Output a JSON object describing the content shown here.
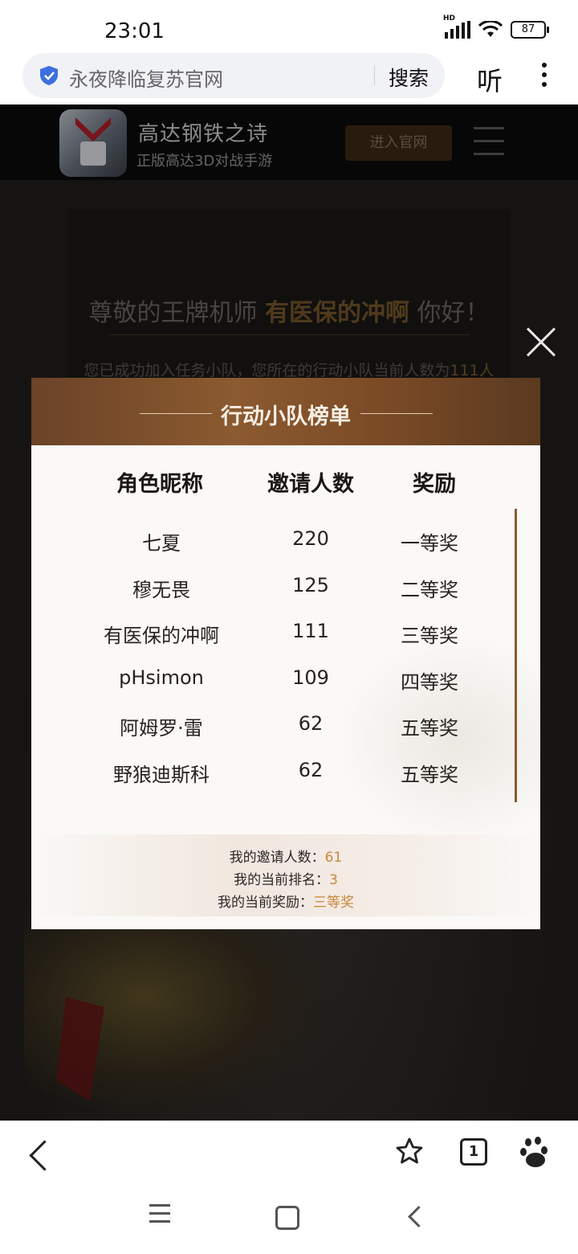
{
  "status": {
    "time": "23:01",
    "battery": "87",
    "network": "HD"
  },
  "browser": {
    "url_title": "永夜降临复苏官网",
    "search_label": "搜索",
    "listen_label": "听",
    "tab_count": "1"
  },
  "site_header": {
    "app_name": "高达钢铁之诗",
    "app_subtitle": "正版高达3D对战手游",
    "enter_button": "进入官网"
  },
  "background": {
    "greeting_prefix": "尊敬的王牌机师",
    "greeting_name": "有医保的冲啊",
    "greeting_suffix": "你好！",
    "joined_text": "您已成功加入任务小队，您所在的行动小队当前人数为",
    "joined_count": "111人"
  },
  "modal": {
    "title": "行动小队榜单",
    "columns": [
      "角色昵称",
      "邀请人数",
      "奖励"
    ],
    "rows": [
      {
        "name": "七夏",
        "count": "220",
        "reward": "一等奖"
      },
      {
        "name": "穆无畏",
        "count": "125",
        "reward": "二等奖"
      },
      {
        "name": "有医保的冲啊",
        "count": "111",
        "reward": "三等奖"
      },
      {
        "name": "pHsimon",
        "count": "109",
        "reward": "四等奖"
      },
      {
        "name": "阿姆罗·雷",
        "count": "62",
        "reward": "五等奖"
      },
      {
        "name": "野狼迪斯科",
        "count": "62",
        "reward": "五等奖"
      }
    ],
    "summary": {
      "invites_label": "我的邀请人数：",
      "invites_value": "61",
      "rank_label": "我的当前排名：",
      "rank_value": "3",
      "reward_label": "我的当前奖励：",
      "reward_value": "三等奖"
    }
  },
  "colors": {
    "accent": "#c8883c",
    "modal_header": "#7a4a26"
  },
  "icons": [
    "shield-icon",
    "more-icon",
    "menu-icon",
    "close-icon",
    "back-icon",
    "star-icon",
    "baidu-paw-icon",
    "nav-menu-icon",
    "nav-home-icon",
    "nav-back-icon"
  ]
}
